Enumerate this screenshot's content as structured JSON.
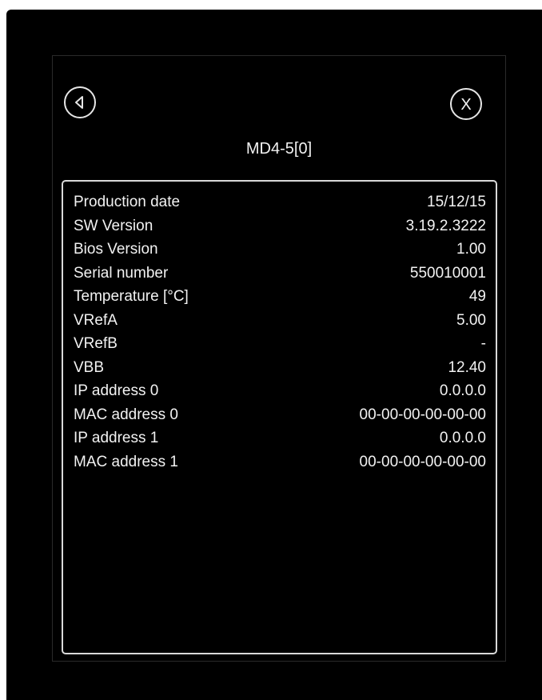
{
  "dialog": {
    "title": "MD4-5[0]",
    "back_icon": "back-triangle-icon",
    "close_label": "X"
  },
  "info": {
    "rows": [
      {
        "label": "Production date",
        "value": "15/12/15"
      },
      {
        "label": "SW Version",
        "value": "3.19.2.3222"
      },
      {
        "label": "Bios Version",
        "value": "1.00"
      },
      {
        "label": "Serial number",
        "value": "550010001"
      },
      {
        "label": "Temperature [°C]",
        "value": "49"
      },
      {
        "label": "VRefA",
        "value": "5.00"
      },
      {
        "label": "VRefB",
        "value": "-"
      },
      {
        "label": "VBB",
        "value": "12.40"
      },
      {
        "label": "IP address 0",
        "value": "0.0.0.0"
      },
      {
        "label": "MAC address 0",
        "value": "00-00-00-00-00-00"
      },
      {
        "label": "IP address 1",
        "value": "0.0.0.0"
      },
      {
        "label": "MAC address 1",
        "value": "00-00-00-00-00-00"
      }
    ]
  },
  "colors": {
    "background": "#000000",
    "text": "#f2f2f2",
    "border": "#d9d9d9"
  }
}
